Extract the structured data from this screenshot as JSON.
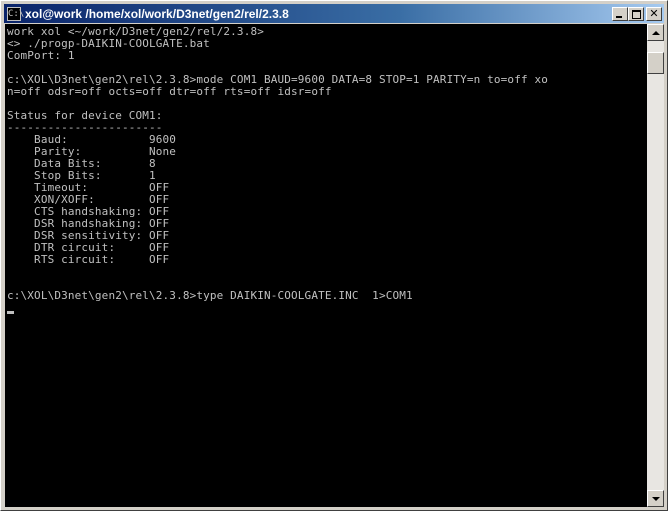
{
  "window": {
    "title": "xol@work /home/xol/work/D3net/gen2/rel/2.3.8",
    "icon": "console-icon",
    "icon_glyph": "C:\\"
  },
  "console": {
    "foreground": "#c0c0c0",
    "background": "#000000",
    "lines": [
      "work xol <~/work/D3net/gen2/rel/2.3.8>",
      "<> ./progp-DAIKIN-COOLGATE.bat",
      "ComPort: 1",
      "",
      "c:\\XOL\\D3net\\gen2\\rel\\2.3.8>mode COM1 BAUD=9600 DATA=8 STOP=1 PARITY=n to=off xo",
      "n=off odsr=off octs=off dtr=off rts=off idsr=off",
      "",
      "Status for device COM1:",
      "-----------------------",
      "    Baud:            9600",
      "    Parity:          None",
      "    Data Bits:       8",
      "    Stop Bits:       1",
      "    Timeout:         OFF",
      "    XON/XOFF:        OFF",
      "    CTS handshaking: OFF",
      "    DSR handshaking: OFF",
      "    DSR sensitivity: OFF",
      "    DTR circuit:     OFF",
      "    RTS circuit:     OFF",
      "",
      "",
      "c:\\XOL\\D3net\\gen2\\rel\\2.3.8>type DAIKIN-COOLGATE.INC  1>COM1"
    ]
  },
  "titlebar_buttons": {
    "minimize_icon": "minimize-icon",
    "maximize_icon": "maximize-icon",
    "close_icon": "close-icon",
    "close_glyph": "✕"
  },
  "scrollbar": {
    "up_icon": "arrow-up-icon",
    "down_icon": "arrow-down-icon"
  }
}
